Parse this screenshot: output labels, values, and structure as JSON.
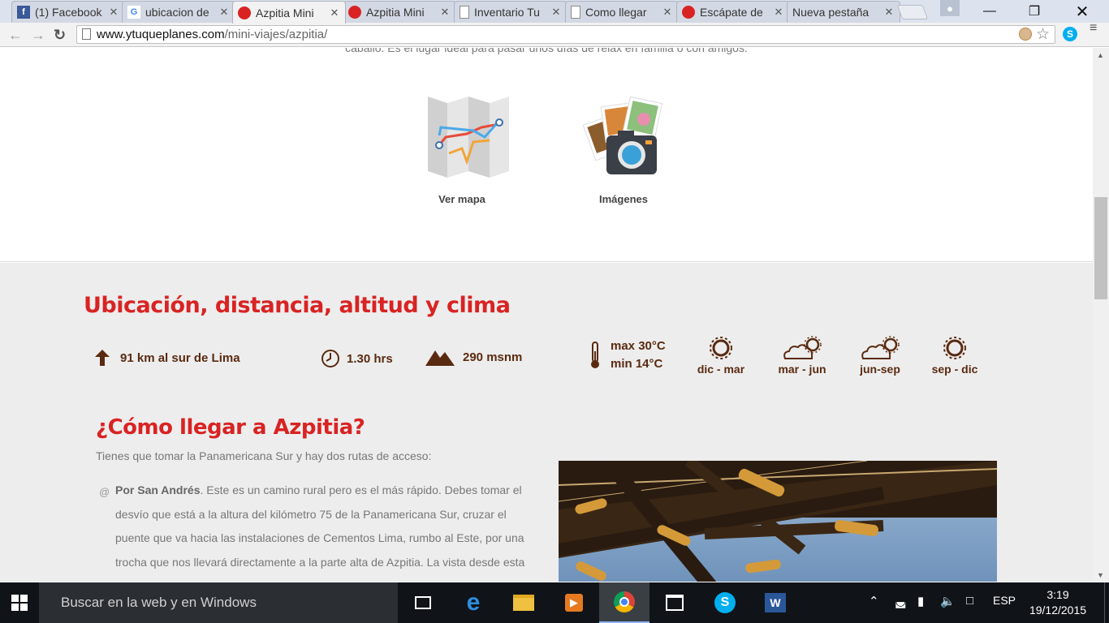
{
  "browser": {
    "tabs": [
      {
        "title": "(1) Facebook",
        "icon": "facebook-icon",
        "color": "#3b5998",
        "active": false
      },
      {
        "title": "ubicacion de",
        "icon": "google-icon",
        "color": "#4285f4",
        "active": false
      },
      {
        "title": "Azpitia Mini",
        "icon": "ytuqueplanes-icon",
        "color": "#d92323",
        "active": true
      },
      {
        "title": "Azpitia Mini",
        "icon": "ytuqueplanes-icon",
        "color": "#d92323",
        "active": false
      },
      {
        "title": "Inventario Tu",
        "icon": "document-icon",
        "color": "#888888",
        "active": false
      },
      {
        "title": "Como llegar",
        "icon": "document-icon",
        "color": "#888888",
        "active": false
      },
      {
        "title": "Escápate de",
        "icon": "escapate-icon",
        "color": "#d92323",
        "active": false
      },
      {
        "title": "Nueva pestaña",
        "icon": "",
        "color": "",
        "active": false
      }
    ],
    "url_host": "www.ytuqueplanes.com",
    "url_path": "/mini-viajes/azpitia/"
  },
  "page": {
    "cut_text": "caballo. Es el lugar ideal para pasar unos días de relax en familia o con amigos.",
    "features": [
      {
        "label": "Ver mapa",
        "icon": "map-icon"
      },
      {
        "label": "Imágenes",
        "icon": "photos-camera-icon"
      }
    ],
    "info_title": "Ubicación, distancia, altitud y clima",
    "info": {
      "distance": "91 km al sur de Lima",
      "time": "1.30 hrs",
      "altitude": "290 msnm",
      "temp_max": "max 30°C",
      "temp_min": "min 14°C"
    },
    "seasons": [
      {
        "label": "dic - mar",
        "icon": "sun-icon"
      },
      {
        "label": "mar - jun",
        "icon": "cloud-sun-icon"
      },
      {
        "label": "jun-sep",
        "icon": "cloud-sun-icon"
      },
      {
        "label": "sep - dic",
        "icon": "sun-icon"
      }
    ],
    "route_title": "¿Cómo llegar a Azpitia?",
    "route_intro": "Tienes que tomar la Panamericana Sur y hay dos rutas de acceso:",
    "route1_bold": "Por San Andrés",
    "route1_text": ". Este es un camino rural pero es el más rápido. Debes tomar el desvío que está a la altura del kilómetro 75 de la Panamericana Sur, cruzar el puente que va hacia las instalaciones de Cementos Lima, rumbo al Este, por una trocha que nos llevará directamente a la parte alta de Azpitia. La vista desde esta parte del"
  },
  "taskbar": {
    "search_placeholder": "Buscar en la web y en Windows",
    "language": "ESP",
    "time": "3:19",
    "date": "19/12/2015"
  }
}
